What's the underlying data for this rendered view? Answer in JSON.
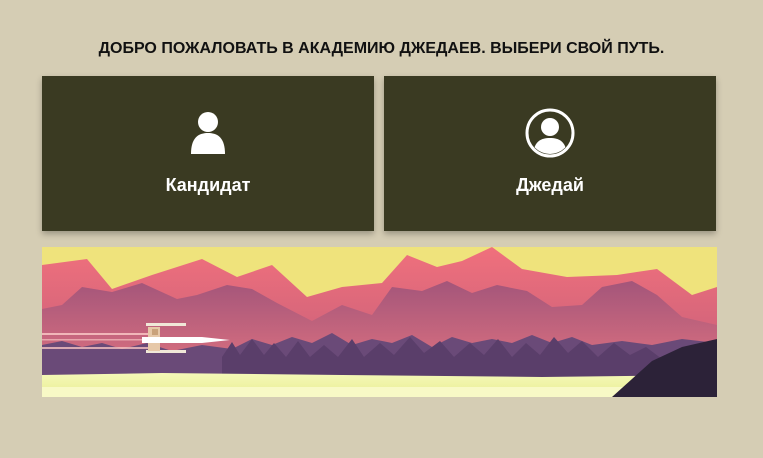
{
  "heading": "ДОБРО ПОЖАЛОВАТЬ В АКАДЕМИЮ ДЖЕДАЕВ. ВЫБЕРИ СВОЙ ПУТЬ.",
  "cards": [
    {
      "label": "Кандидат",
      "icon": "user-icon"
    },
    {
      "label": "Джедай",
      "icon": "user-circle-icon"
    }
  ],
  "banner": {
    "icon": "x-wing-over-mountains"
  },
  "colors": {
    "background": "#d5cdb4",
    "card": "#3a3a22",
    "card_text": "#ffffff",
    "sky": "#efe37c",
    "mountain_pink": "#e8707a",
    "mountain_purple": "#6a4a78",
    "ground": "#f2f7a8"
  }
}
